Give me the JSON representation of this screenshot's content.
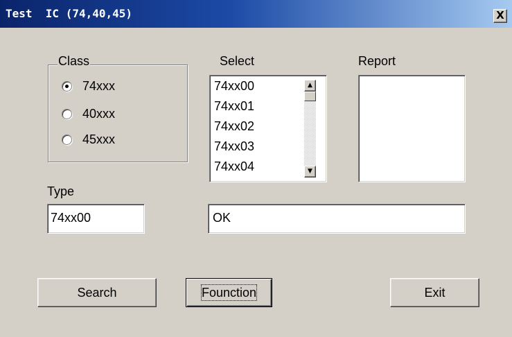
{
  "window": {
    "title": "Test  IC (74,40,45)",
    "close_label": "X"
  },
  "class_group": {
    "label": "Class",
    "options": [
      {
        "label": "74xxx",
        "selected": true
      },
      {
        "label": "40xxx",
        "selected": false
      },
      {
        "label": "45xxx",
        "selected": false
      }
    ]
  },
  "select": {
    "label": "Select",
    "items": [
      "74xx00",
      "74xx01",
      "74xx02",
      "74xx03",
      "74xx04"
    ],
    "scroll_up_icon": "▲",
    "scroll_down_icon": "▼"
  },
  "report": {
    "label": "Report",
    "value": ""
  },
  "type": {
    "label": "Type",
    "value": "74xx00"
  },
  "status": {
    "value": "OK"
  },
  "buttons": {
    "search": "Search",
    "function": "Founction",
    "exit": "Exit"
  },
  "colors": {
    "title_bar_start": "#0a246a",
    "title_bar_end": "#a6caf0",
    "face": "#d4d0c8"
  }
}
